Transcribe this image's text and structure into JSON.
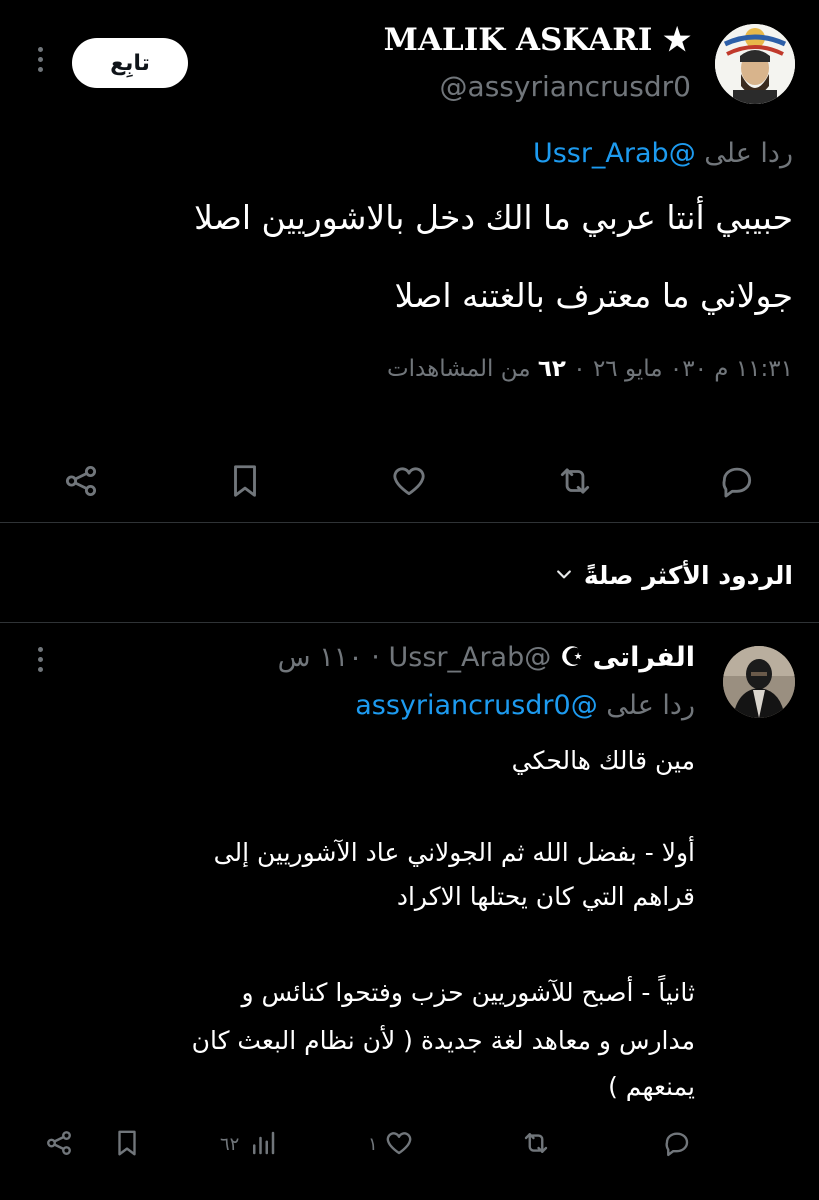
{
  "main_tweet": {
    "display_name": "MALIK ASKARI ★",
    "handle": "@assyriancrusdr0",
    "follow_label": "تابِع",
    "reply_prefix": "ردا على",
    "reply_to": "@Ussr_Arab",
    "body_lines": [
      "حبيبي أنتا عربي ما الك دخل بالاشوريين اصلا",
      "جولاني ما معترف بالغتنه اصلا"
    ],
    "meta_time": "١١:٣١ م ٠٣٠ مايو ٢٦ ٠",
    "meta_views_count": "٦٢",
    "meta_views_label": "من المشاهدات",
    "actions": [
      "reply",
      "repost",
      "like",
      "bookmark",
      "share"
    ]
  },
  "sort": {
    "label": "الردود الأكثر صلةً"
  },
  "reply_tweet": {
    "display_name": "الفراتى",
    "flag_glyph": "☪",
    "handle": "@Ussr_Arab",
    "time": "١١٠ س",
    "reply_prefix": "ردا على",
    "reply_to": "@assyriancrusdr0",
    "lines": [
      "مين قالك هالحكي",
      "أولا - بفضل الله ثم الجولاني عاد الآشوريين إلى",
      "قراهم التي كان يحتلها الاكراد",
      "ثانياً - أصبح للآشوريين حزب وفتحوا كنائس و",
      "مدارس و معاهد لغة جديدة ( لأن نظام البعث كان",
      "يمنعهم )"
    ],
    "like_count": "١",
    "views_count": "٦٢"
  },
  "colors": {
    "background": "#000000",
    "text": "#e7e9ea",
    "muted": "#71767b",
    "link": "#1d9bf0",
    "divider": "#2f3336"
  }
}
